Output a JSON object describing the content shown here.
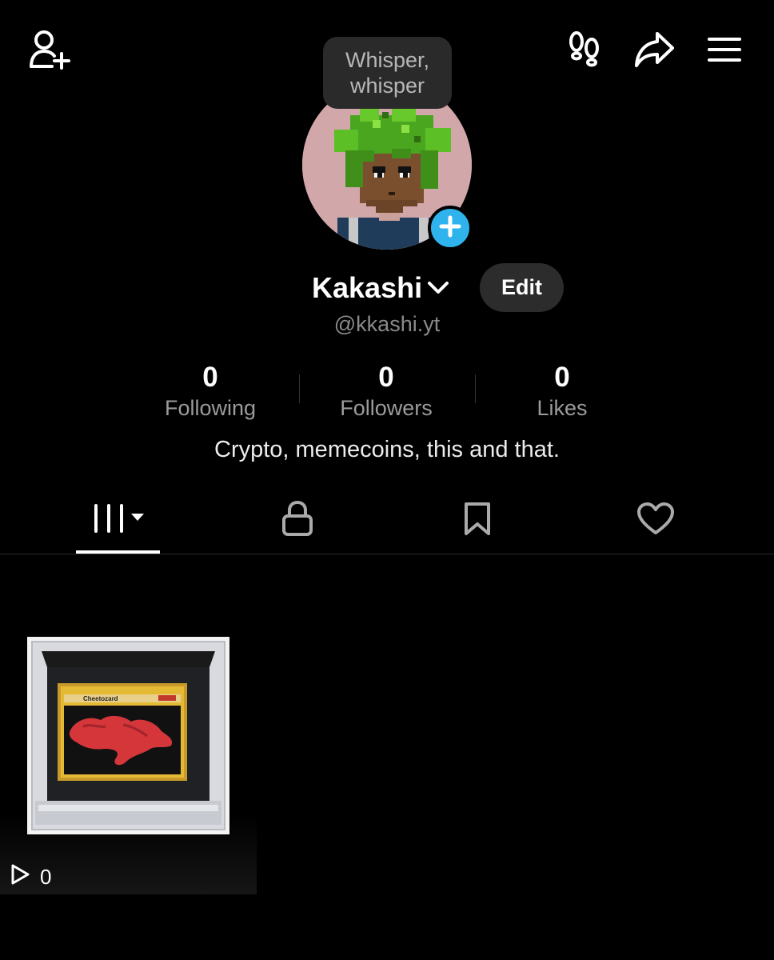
{
  "header": {
    "add_friend_icon": "person-add-icon",
    "footprints_icon": "footprints-icon",
    "share_icon": "share-arrow-icon",
    "menu_icon": "hamburger-menu-icon"
  },
  "bubble": {
    "line1": "Whisper,",
    "line2": "whisper"
  },
  "profile": {
    "name": "Kakashi",
    "handle": "@kkashi.yt",
    "edit_label": "Edit",
    "bio": "Crypto, memecoins, this and that.",
    "avatar_badge_color": "#2fb3ec"
  },
  "stats": [
    {
      "value": "0",
      "label": "Following"
    },
    {
      "value": "0",
      "label": "Followers"
    },
    {
      "value": "0",
      "label": "Likes"
    }
  ],
  "tabs": [
    {
      "icon": "videos-grid-icon",
      "active": true
    },
    {
      "icon": "lock-icon",
      "active": false
    },
    {
      "icon": "bookmark-icon",
      "active": false
    },
    {
      "icon": "heart-icon",
      "active": false
    }
  ],
  "videos": [
    {
      "views": "0",
      "card_title": "Cheetozard"
    }
  ]
}
